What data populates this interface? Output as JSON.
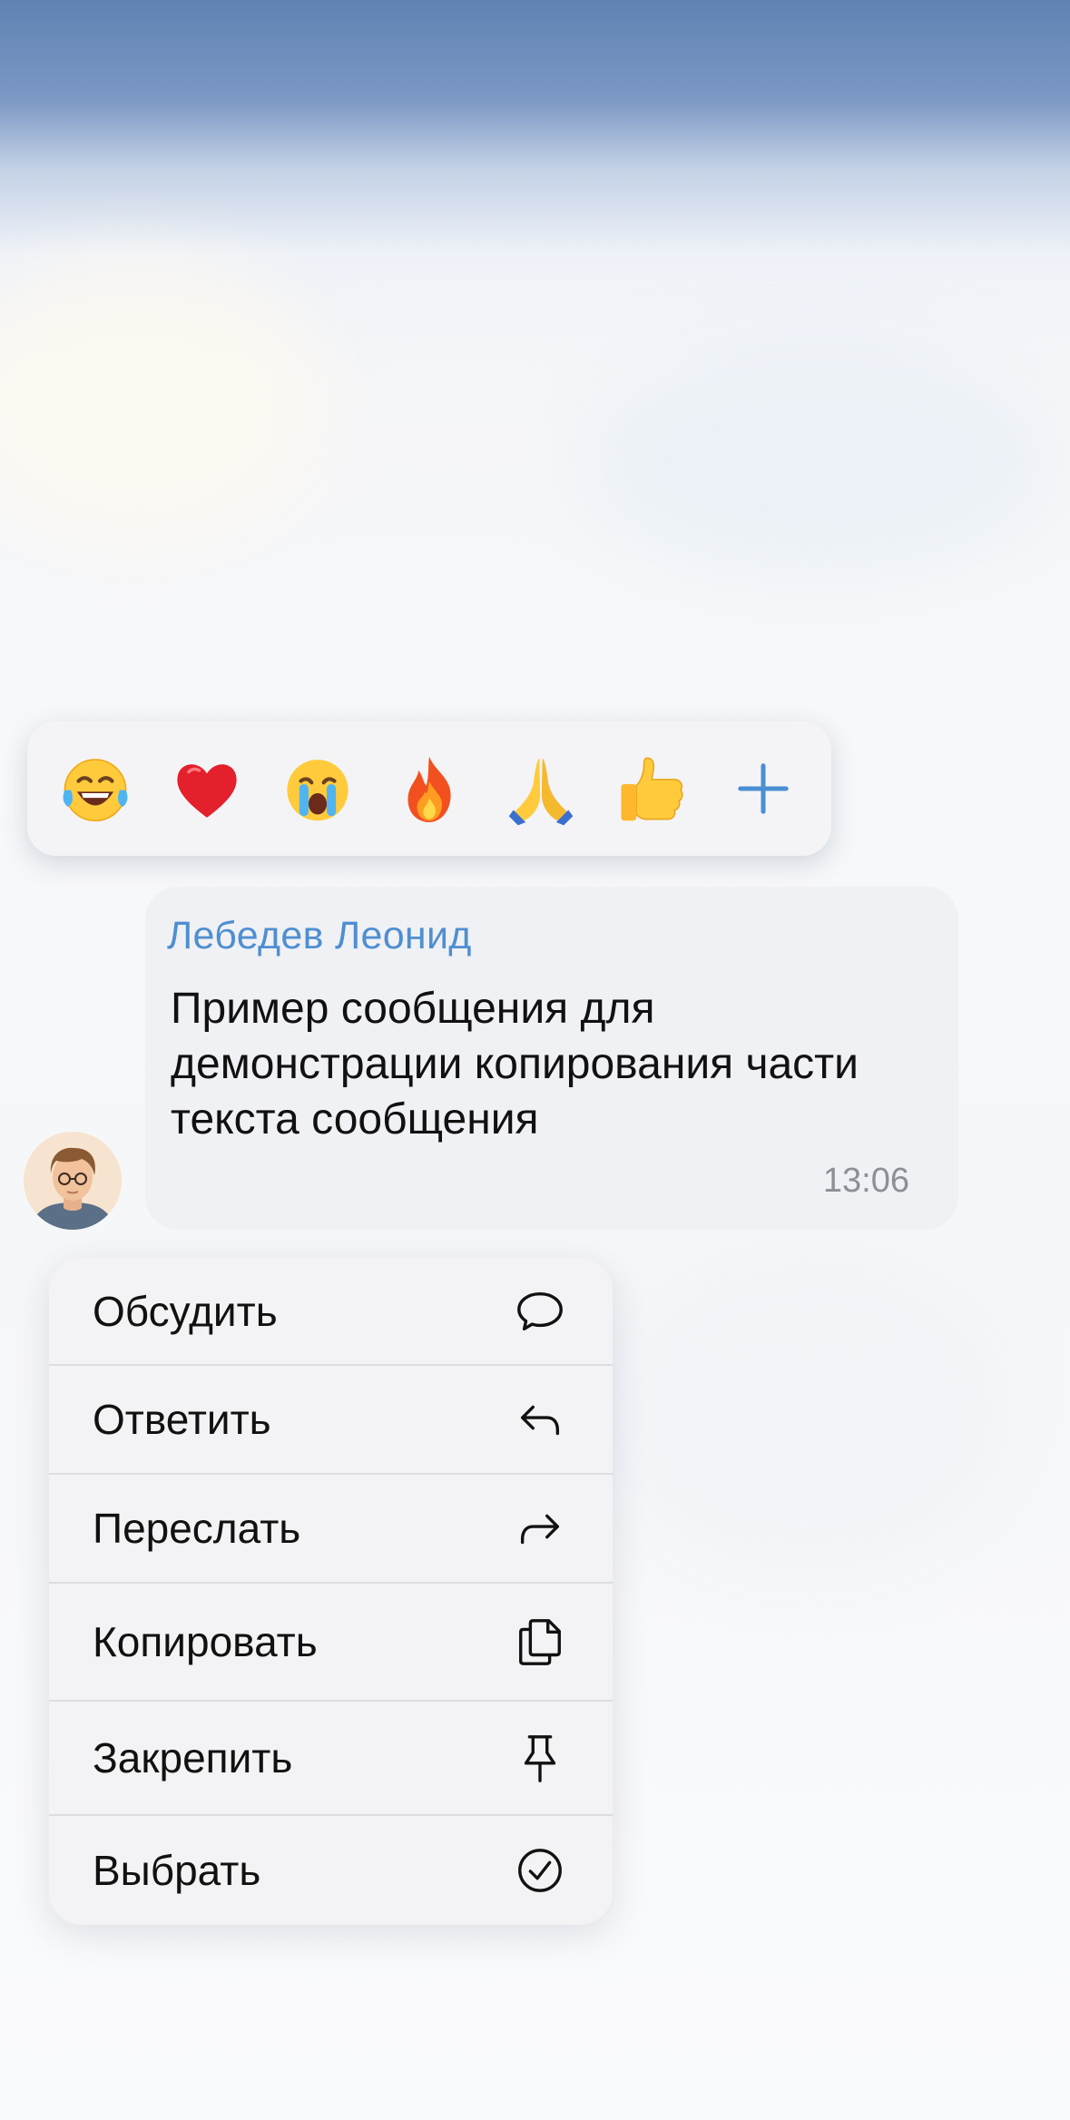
{
  "reactions": [
    {
      "icon": "laughing-tears-emoji"
    },
    {
      "icon": "red-heart-emoji"
    },
    {
      "icon": "crying-face-emoji"
    },
    {
      "icon": "fire-emoji"
    },
    {
      "icon": "praying-hands-emoji"
    },
    {
      "icon": "thumbs-up-emoji"
    },
    {
      "icon": "plus-icon"
    }
  ],
  "message": {
    "sender": "Лебедев Леонид",
    "text": "Пример сообщения для демонстрации копирования части текста сообщения",
    "time": "13:06",
    "sender_color": "#4f8fd1"
  },
  "menu": {
    "items": [
      {
        "label": "Обсудить",
        "icon": "speech-bubble-icon"
      },
      {
        "label": "Ответить",
        "icon": "reply-arrow-icon"
      },
      {
        "label": "Переслать",
        "icon": "forward-arrow-icon"
      },
      {
        "label": "Копировать",
        "icon": "copy-documents-icon"
      },
      {
        "label": "Закрепить",
        "icon": "pin-icon"
      },
      {
        "label": "Выбрать",
        "icon": "checkmark-circle-icon"
      }
    ]
  },
  "colors": {
    "accent": "#4f8fd1",
    "bubble": "#f0f1f4",
    "menu": "#f3f3f5",
    "top_gradient": "#5f82b3"
  }
}
